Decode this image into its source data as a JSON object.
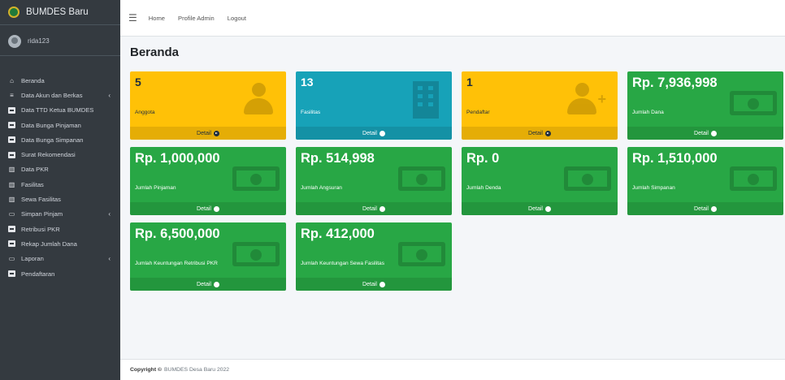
{
  "app": {
    "brand": "BUMDES Baru",
    "username": "rida123"
  },
  "sidebar": {
    "items": [
      {
        "label": "Beranda",
        "icon": "home-icon",
        "glyph": "⌂",
        "caret": ""
      },
      {
        "label": "Data Akun dan Berkas",
        "icon": "database-icon",
        "glyph": "≡",
        "caret": "‹"
      },
      {
        "label": "Data TTD Ketua BUMDES",
        "icon": "id-card-icon",
        "glyph": "",
        "caret": ""
      },
      {
        "label": "Data Bunga Pinjaman",
        "icon": "id-card-icon",
        "glyph": "",
        "caret": ""
      },
      {
        "label": "Data Bunga Simpanan",
        "icon": "id-card-icon",
        "glyph": "",
        "caret": ""
      },
      {
        "label": "Surat Rekomendasi",
        "icon": "id-card-icon",
        "glyph": "",
        "caret": ""
      },
      {
        "label": "Data PKR",
        "icon": "building-icon",
        "glyph": "▥",
        "caret": ""
      },
      {
        "label": "Fasilitas",
        "icon": "building-icon",
        "glyph": "▥",
        "caret": ""
      },
      {
        "label": "Sewa Fasilitas",
        "icon": "building-icon",
        "glyph": "▥",
        "caret": ""
      },
      {
        "label": "Simpan Pinjam",
        "icon": "money-icon",
        "glyph": "▭",
        "caret": "‹"
      },
      {
        "label": "Retribusi PKR",
        "icon": "id-card-icon",
        "glyph": "",
        "caret": ""
      },
      {
        "label": "Rekap Jumlah Dana",
        "icon": "id-card-icon",
        "glyph": "",
        "caret": ""
      },
      {
        "label": "Laporan",
        "icon": "money-icon",
        "glyph": "▭",
        "caret": "‹"
      },
      {
        "label": "Pendaftaran",
        "icon": "id-card-icon",
        "glyph": "",
        "caret": ""
      }
    ]
  },
  "topnav": {
    "home": "Home",
    "profile": "Profile Admin",
    "logout": "Logout"
  },
  "page": {
    "title": "Beranda"
  },
  "boxes": [
    {
      "value": "5",
      "label": "Anggota",
      "detail": "Detail",
      "color": "#ffc107",
      "icon": "user-icon"
    },
    {
      "value": "13",
      "label": "Fasilitas",
      "detail": "Detail",
      "color": "#17a2b8",
      "icon": "building-icon"
    },
    {
      "value": "1",
      "label": "Pendaftar",
      "detail": "Detail",
      "color": "#ffc107",
      "icon": "user-plus-icon"
    },
    {
      "value": "Rp. 7,936,998",
      "label": "Jumlah Dana",
      "detail": "Detail",
      "color": "#28a745",
      "icon": "money-icon"
    },
    {
      "value": "Rp. 1,000,000",
      "label": "Jumlah Pinjaman",
      "detail": "Detail",
      "color": "#28a745",
      "icon": "money-icon"
    },
    {
      "value": "Rp. 514,998",
      "label": "Jumlah Angsuran",
      "detail": "Detail",
      "color": "#28a745",
      "icon": "money-icon"
    },
    {
      "value": "Rp. 0",
      "label": "Jumlah Denda",
      "detail": "Detail",
      "color": "#28a745",
      "icon": "money-icon"
    },
    {
      "value": "Rp. 1,510,000",
      "label": "Jumlah Simpanan",
      "detail": "Detail",
      "color": "#28a745",
      "icon": "money-icon"
    },
    {
      "value": "Rp. 6,500,000",
      "label": "Jumlah Keuntungan Retribusi PKR",
      "detail": "Detail",
      "color": "#28a745",
      "icon": "money-icon"
    },
    {
      "value": "Rp. 412,000",
      "label": "Jumlah Keuntungan Sewa Fasilitas",
      "detail": "Detail",
      "color": "#28a745",
      "icon": "money-icon"
    }
  ],
  "footer": {
    "copyright_bold": "Copyright ©",
    "copyright_text": "BUMDES Desa Baru 2022"
  }
}
